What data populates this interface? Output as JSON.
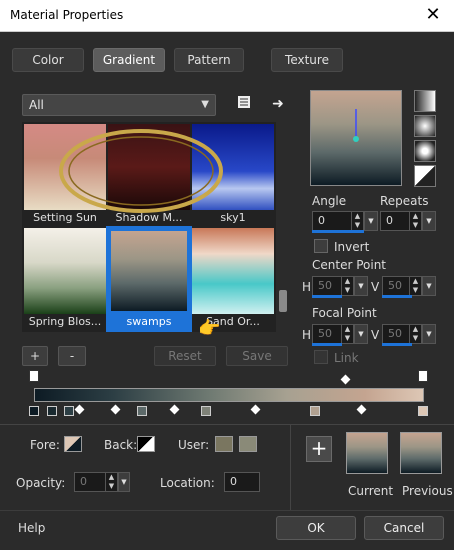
{
  "window": {
    "title": "Material Properties",
    "close_glyph": "✕"
  },
  "tabs": [
    {
      "label": "Color",
      "active": false
    },
    {
      "label": "Gradient",
      "active": true
    },
    {
      "label": "Pattern",
      "active": false
    },
    {
      "label": "Texture",
      "active": false
    }
  ],
  "category_dropdown": {
    "value": "All"
  },
  "swatches": [
    {
      "label": "Setting Sun",
      "selected": false
    },
    {
      "label": "Shadow M...",
      "selected": false
    },
    {
      "label": "sky1",
      "selected": false
    },
    {
      "label": "Spring Blos...",
      "selected": false
    },
    {
      "label": "swamps",
      "selected": true
    },
    {
      "label": "Sand Or...",
      "selected": false
    }
  ],
  "swatch_buttons": {
    "add": "+",
    "remove": "-",
    "reset": "Reset",
    "save": "Save"
  },
  "angle": {
    "label": "Angle",
    "value": "0"
  },
  "repeats": {
    "label": "Repeats",
    "value": "0"
  },
  "invert": {
    "label": "Invert",
    "checked": false
  },
  "center_point": {
    "label": "Center Point",
    "h_label": "H",
    "h_value": "50",
    "v_label": "V",
    "v_value": "50"
  },
  "focal_point": {
    "label": "Focal Point",
    "h_label": "H",
    "h_value": "50",
    "v_label": "V",
    "v_value": "50"
  },
  "link": {
    "label": "Link",
    "checked": false
  },
  "colors": {
    "fore_label": "Fore:",
    "back_label": "Back:",
    "user_label": "User:",
    "user_swatch_1": "#7a7660",
    "user_swatch_2": "#8a8a78"
  },
  "opacity": {
    "label": "Opacity:",
    "value": "0"
  },
  "location": {
    "label": "Location:",
    "value": "0"
  },
  "preview_labels": {
    "current": "Current",
    "previous": "Previous",
    "add_glyph": "+"
  },
  "footer": {
    "help": "Help",
    "ok": "OK",
    "cancel": "Cancel"
  },
  "accent_color": "#1e73d8"
}
